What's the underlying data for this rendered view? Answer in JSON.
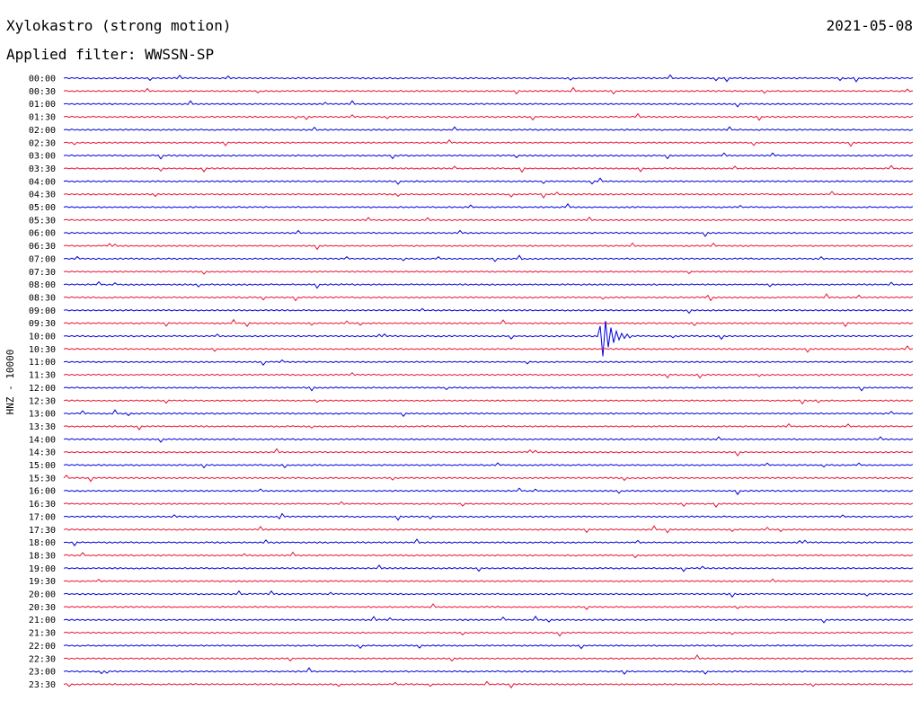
{
  "header": {
    "title": "Xylokastro (strong motion)",
    "date": "2021-05-08",
    "filter": "Applied filter: WWSSN-SP"
  },
  "chart_data": {
    "type": "line",
    "ylabel": "HNZ - 10000",
    "colors": {
      "even_rows": "#0000dd",
      "odd_rows": "#ee1133"
    },
    "rows": [
      "00:00",
      "00:30",
      "01:00",
      "01:30",
      "02:00",
      "02:30",
      "03:00",
      "03:30",
      "04:00",
      "04:30",
      "05:00",
      "05:30",
      "06:00",
      "06:30",
      "07:00",
      "07:30",
      "08:00",
      "08:30",
      "09:00",
      "09:30",
      "10:00",
      "10:30",
      "11:00",
      "11:30",
      "12:00",
      "12:30",
      "13:00",
      "13:30",
      "14:00",
      "14:30",
      "15:00",
      "15:30",
      "16:00",
      "16:30",
      "17:00",
      "17:30",
      "18:00",
      "18:30",
      "19:00",
      "19:30",
      "20:00",
      "20:30",
      "21:00",
      "21:30",
      "22:00",
      "22:30",
      "23:00",
      "23:30"
    ],
    "events": [
      {
        "row": "10:00",
        "time_fraction": 0.635,
        "label": ""
      }
    ]
  }
}
